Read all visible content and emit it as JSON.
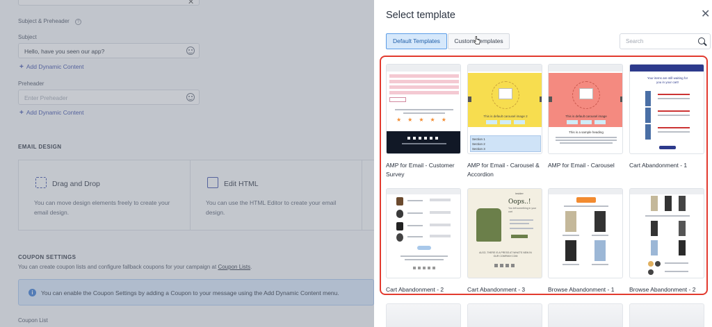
{
  "form": {
    "subject_preheader_label": "Subject & Preheader",
    "subject_label": "Subject",
    "subject_value": "Hello, have you seen our app?",
    "add_dynamic_content_1": "Add Dynamic Content",
    "preheader_label": "Preheader",
    "preheader_placeholder": "Enter Preheader",
    "add_dynamic_content_2": "Add Dynamic Content",
    "email_design_heading": "EMAIL DESIGN",
    "drag_drop_title": "Drag and Drop",
    "drag_drop_desc": "You can move design elements freely to create your email design.",
    "edit_html_title": "Edit HTML",
    "edit_html_desc": "You can use the HTML Editor to create your email design.",
    "coupon_heading": "COUPON SETTINGS",
    "coupon_desc_text": "You can create coupon lists and configure fallback coupons for your campaign at",
    "coupon_link": "Coupon Lists",
    "coupon_info": "You can enable the Coupon Settings by adding a Coupon to your message using the Add Dynamic Content menu.",
    "coupon_list_label": "Coupon List"
  },
  "modal": {
    "title": "Select template",
    "close_icon": "close-icon",
    "tabs": [
      {
        "label": "Default Templates",
        "active": true
      },
      {
        "label": "Custom Templates",
        "active": false
      }
    ],
    "search_placeholder": "Search",
    "templates": [
      {
        "name": "AMP for Email - Customer Survey"
      },
      {
        "name": "AMP for Email - Carousel & Accordion"
      },
      {
        "name": "AMP for Email - Carousel"
      },
      {
        "name": "Cart Abandonment - 1"
      },
      {
        "name": "Cart Abandonment - 2"
      },
      {
        "name": "Cart Abandonment - 3"
      },
      {
        "name": "Browse Abandonment - 1"
      },
      {
        "name": "Browse Abandonment - 2"
      }
    ],
    "thumbnail_text": {
      "carousel2_caption": "This is default carousel image 2",
      "carousel_caption": "This is default carousel image",
      "sample_heading": "This is a sample heading",
      "sections": [
        "Section 1",
        "Section 2",
        "Section 3"
      ],
      "cart1_heading": "Your items are still waiting for you in your cart!",
      "oops": "Oops..!",
      "oops_sub": "You left something in your cart",
      "also_there": "ALSO, THERE IS A PRESS AT WHAT'S NEW IN OUR COMPANY.COM",
      "insider": "insider"
    },
    "accent_color": "#e23a2e",
    "tab_active_color": "#d6e8fb"
  }
}
